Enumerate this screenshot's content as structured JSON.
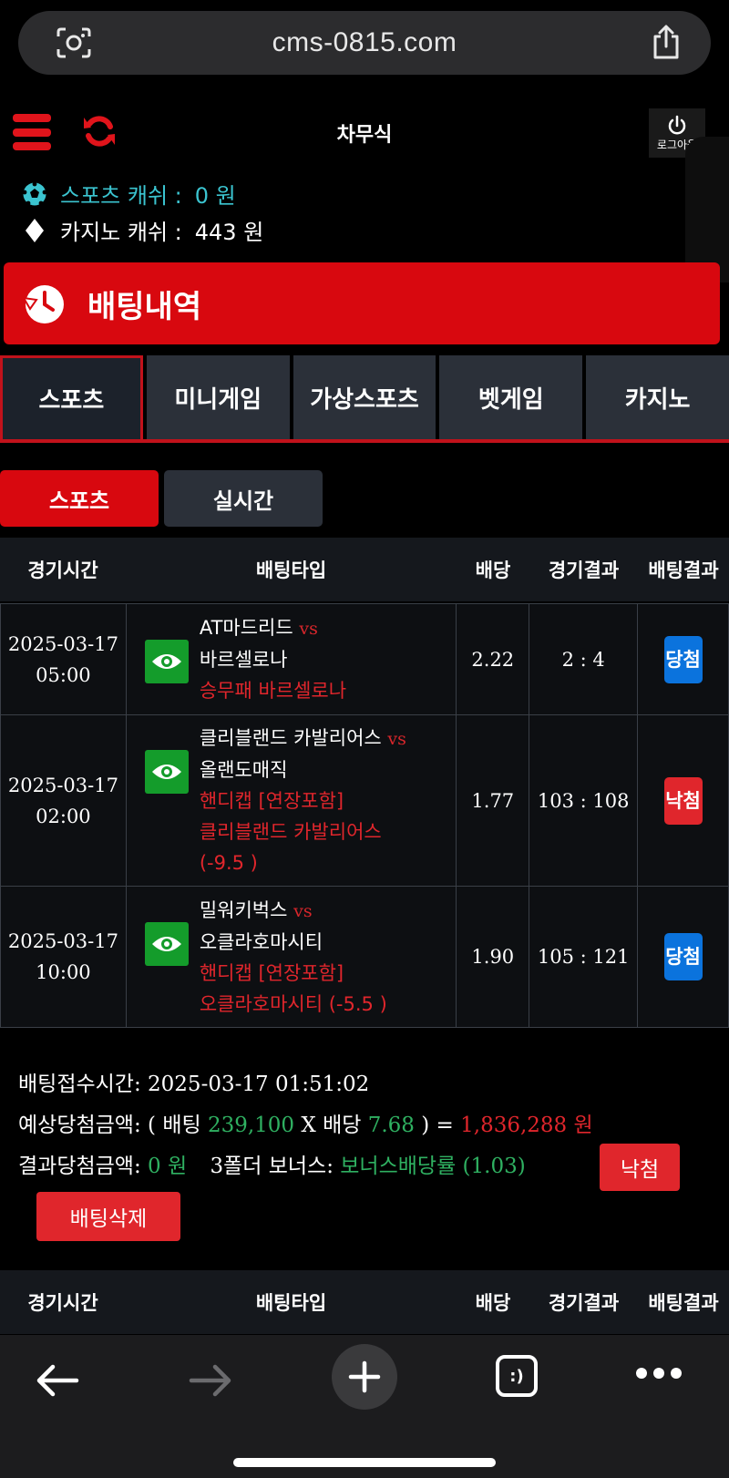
{
  "browser": {
    "url": "cms-0815.com",
    "tabs_label": ":)"
  },
  "header": {
    "logo_text": "차무식",
    "logout_label": "로그아웃",
    "sports_cash_label": "스포츠 캐쉬 :",
    "sports_cash_value": "0 원",
    "casino_cash_label": "카지노 캐쉬 :",
    "casino_cash_value": "443 원"
  },
  "page": {
    "title": "배팅내역"
  },
  "tabs": [
    {
      "label": "스포츠",
      "active": true
    },
    {
      "label": "미니게임",
      "active": false
    },
    {
      "label": "가상스포츠",
      "active": false
    },
    {
      "label": "벳게임",
      "active": false
    },
    {
      "label": "카지노",
      "active": false
    }
  ],
  "subtabs": [
    {
      "label": "스포츠",
      "active": true
    },
    {
      "label": "실시간",
      "active": false
    }
  ],
  "table": {
    "headers": [
      "경기시간",
      "배팅타입",
      "배당",
      "경기결과",
      "배팅결과"
    ],
    "rows": [
      {
        "date": "2025-03-17",
        "time": "05:00",
        "home": "AT마드리드",
        "vs": "vs",
        "away": "바르셀로나",
        "pick_lines": [
          "승무패 바르셀로나"
        ],
        "odds": "2.22",
        "score": "2 : 4",
        "result": "당첨",
        "result_type": "win"
      },
      {
        "date": "2025-03-17",
        "time": "02:00",
        "home": "클리블랜드 카발리어스",
        "vs": "vs",
        "away": "올랜도매직",
        "pick_lines": [
          "핸디캡 [연장포함]",
          "클리블랜드 카발리어스",
          "(-9.5 )"
        ],
        "odds": "1.77",
        "score": "103 : 108",
        "result": "낙첨",
        "result_type": "lose"
      },
      {
        "date": "2025-03-17",
        "time": "10:00",
        "home": "밀워키벅스",
        "vs": "vs",
        "away": "오클라호마시티",
        "pick_lines": [
          "핸디캡 [연장포함]",
          "오클라호마시티 (-5.5 )"
        ],
        "odds": "1.90",
        "score": "105 : 121",
        "result": "당첨",
        "result_type": "win"
      }
    ]
  },
  "summary": {
    "accept_label": "배팅접수시간:",
    "accept_value": "2025-03-17 01:51:02",
    "expected_label": "예상당첨금액:",
    "expected_open": "( 배팅",
    "bet_amount": "239,100",
    "times_odds": "X 배당",
    "total_odds": "7.68",
    "expected_close": ") =",
    "expected_amount": "1,836,288 원",
    "result_label": "결과당첨금액:",
    "result_amount": "0 원",
    "bonus_label": "3폴더 보너스:",
    "bonus_value": "보너스배당률 (1.03)",
    "status": "낙첨",
    "delete_label": "배팅삭제"
  },
  "colors": {
    "accent_red": "#d8080f",
    "win_blue": "#0b73dd",
    "lose_red": "#e0262c",
    "eye_green": "#149c2b",
    "cash_cyan": "#3bc4d0",
    "value_green": "#2fb061"
  },
  "icons": {
    "url_left": "camera-scan-icon",
    "url_right": "share-icon",
    "menu": "hamburger-icon",
    "refresh": "refresh-icon",
    "logout": "power-icon",
    "sports_cash": "soccer-ball-icon",
    "casino_cash": "diamond-icon",
    "title": "history-clock-icon",
    "detail": "eye-icon"
  }
}
